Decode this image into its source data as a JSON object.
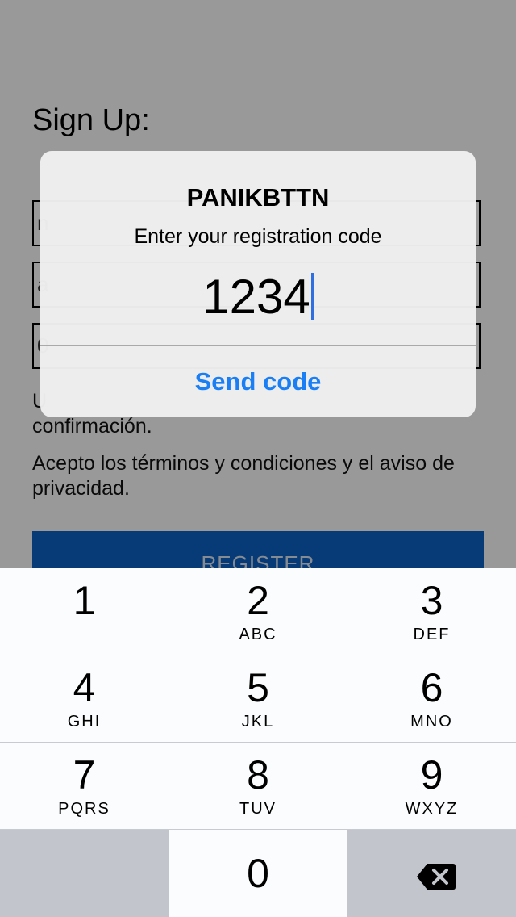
{
  "signup": {
    "title": "Sign Up:",
    "field_1_value": "n",
    "field_2_value": "a",
    "field_3_value": "0",
    "email_hint": "U",
    "email_hint_line2": "confirmación.",
    "terms": "Acepto los términos y condiciones y el aviso de privacidad.",
    "register_label": "REGISTER"
  },
  "alert": {
    "title": "PANIKBTTN",
    "message": "Enter your registration code",
    "code_value": "1234",
    "action_label": "Send code"
  },
  "keyboard": {
    "keys": [
      {
        "digit": "1",
        "letters": ""
      },
      {
        "digit": "2",
        "letters": "ABC"
      },
      {
        "digit": "3",
        "letters": "DEF"
      },
      {
        "digit": "4",
        "letters": "GHI"
      },
      {
        "digit": "5",
        "letters": "JKL"
      },
      {
        "digit": "6",
        "letters": "MNO"
      },
      {
        "digit": "7",
        "letters": "PQRS"
      },
      {
        "digit": "8",
        "letters": "TUV"
      },
      {
        "digit": "9",
        "letters": "WXYZ"
      }
    ],
    "zero_label": "0",
    "delete_icon": "backspace-icon"
  },
  "colors": {
    "accent": "#1a7ef5",
    "register_button": "#0a63c9",
    "caret": "#2f6fe0"
  }
}
